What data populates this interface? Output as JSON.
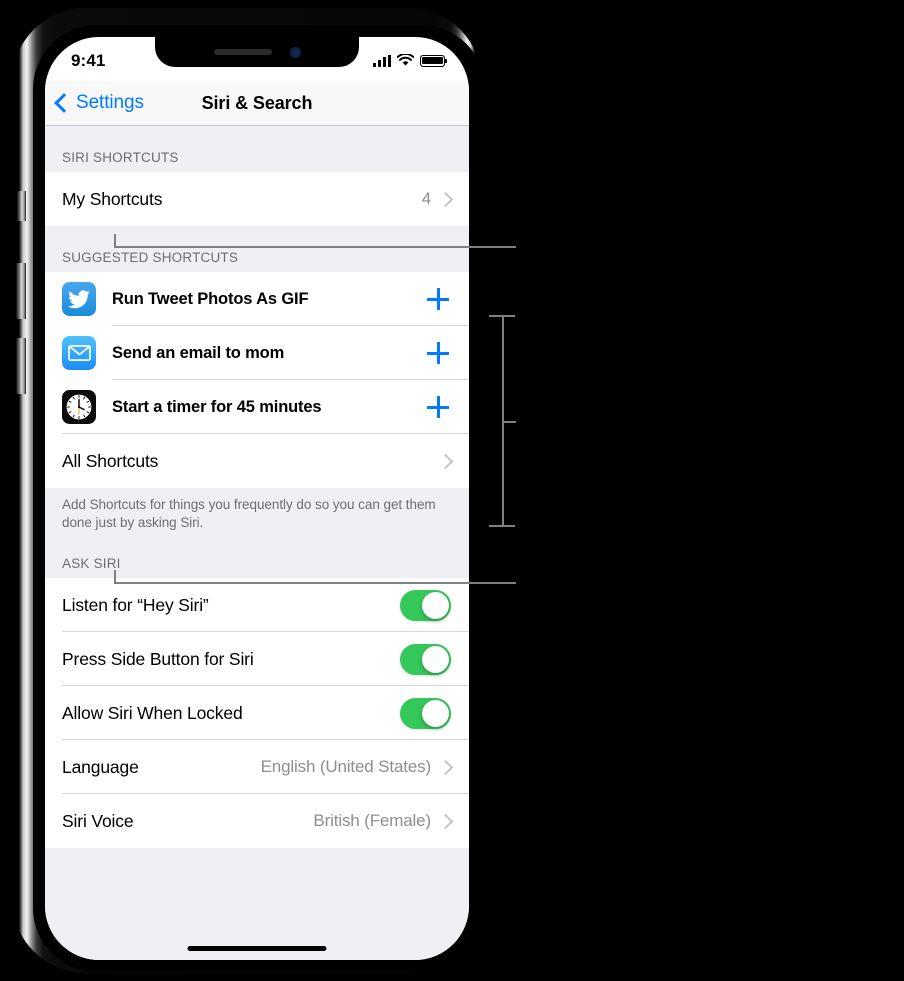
{
  "status_bar": {
    "time": "9:41",
    "icons": [
      "cellular-signal-icon",
      "wifi-icon",
      "battery-icon"
    ]
  },
  "nav_bar": {
    "back_label": "Settings",
    "title": "Siri & Search"
  },
  "sections": [
    {
      "header": "SIRI SHORTCUTS",
      "rows": [
        {
          "label": "My Shortcuts",
          "value": "4",
          "accessory": "chevron"
        }
      ]
    },
    {
      "header": "SUGGESTED SHORTCUTS",
      "rows": [
        {
          "label": "Run Tweet Photos As GIF",
          "icon": "twitter-icon",
          "accessory": "plus"
        },
        {
          "label": "Send an email to mom",
          "icon": "mail-icon",
          "accessory": "plus"
        },
        {
          "label": "Start a timer for 45 minutes",
          "icon": "clock-icon",
          "accessory": "plus"
        },
        {
          "label": "All Shortcuts",
          "accessory": "chevron"
        }
      ],
      "footer": "Add Shortcuts for things you frequently do so you can get them done just by asking Siri."
    },
    {
      "header": "ASK SIRI",
      "rows": [
        {
          "label": "Listen for “Hey Siri”",
          "accessory": "toggle",
          "toggle_on": true
        },
        {
          "label": "Press Side Button for Siri",
          "accessory": "toggle",
          "toggle_on": true
        },
        {
          "label": "Allow Siri When Locked",
          "accessory": "toggle",
          "toggle_on": true
        },
        {
          "label": "Language",
          "value": "English (United States)",
          "accessory": "chevron"
        },
        {
          "label": "Siri Voice",
          "value": "British (Female)",
          "accessory": "chevron"
        }
      ]
    }
  ],
  "colors": {
    "accent_blue": "#007aff",
    "toggle_green": "#34c759",
    "group_background": "#efeff4",
    "separator": "#d6d6da",
    "secondary_text": "#8e8e93",
    "callout_line": "#808080"
  }
}
